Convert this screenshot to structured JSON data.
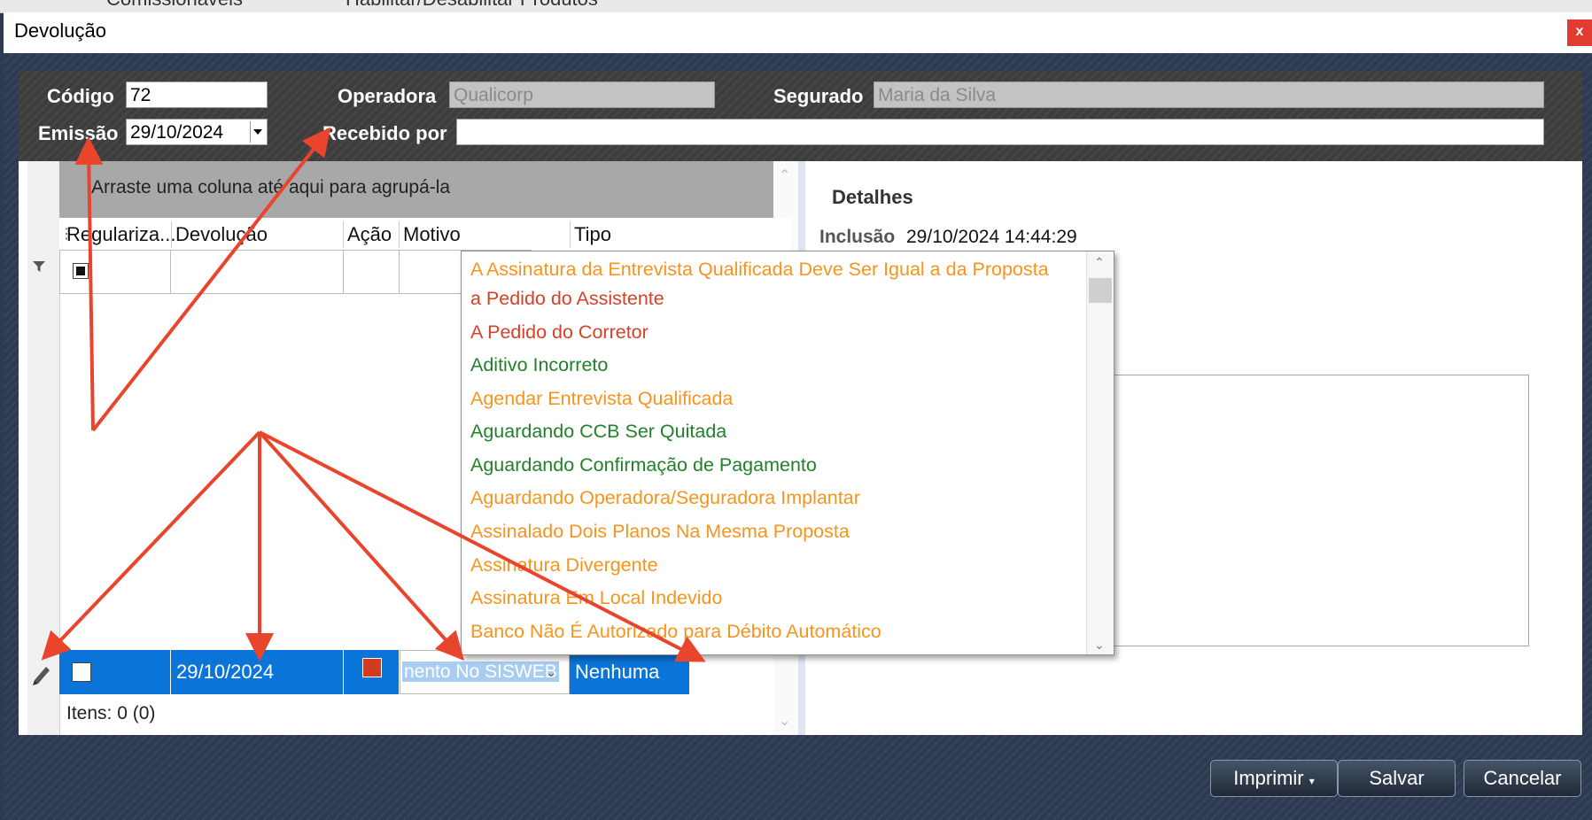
{
  "background_app": {
    "items": [
      "Comissionáveis",
      "Habilitar/Desabilitar Produtos"
    ]
  },
  "window": {
    "title": "Devolução",
    "close_label": "x"
  },
  "header": {
    "codigo_label": "Código",
    "codigo_value": "72",
    "operadora_label": "Operadora",
    "operadora_value": "Qualicorp",
    "segurado_label": "Segurado",
    "segurado_value": "Maria da Silva",
    "emissao_label": "Emissão",
    "emissao_value": "29/10/2024",
    "recebido_label": "Recebido por",
    "recebido_value": ""
  },
  "grid": {
    "group_hint": "Arraste uma coluna até aqui para agrupá-la",
    "columns": [
      "Regulariza...",
      "Devolução",
      "Ação",
      "Motivo",
      "Tipo"
    ],
    "edit_row": {
      "devolucao": "29/10/2024",
      "motivo": "nento No SISWEB",
      "tipo": "Nenhuma"
    },
    "footer": "Itens: 0 (0)"
  },
  "details": {
    "title": "Detalhes",
    "inclusao_label": "Inclusão",
    "inclusao_value": "29/10/2024 14:44:29"
  },
  "motivo_dropdown": {
    "items": [
      {
        "label": "A Assinatura da Entrevista Qualificada Deve Ser Igual a da Proposta",
        "color": "#f7941d"
      },
      {
        "label": "a Pedido do Assistente",
        "color": "#d64127"
      },
      {
        "label": "A Pedido do Corretor",
        "color": "#d64127"
      },
      {
        "label": "Aditivo Incorreto",
        "color": "#23802a"
      },
      {
        "label": "Agendar Entrevista Qualificada",
        "color": "#f7941d"
      },
      {
        "label": "Aguardando CCB Ser Quitada",
        "color": "#23802a"
      },
      {
        "label": "Aguardando Confirmação de Pagamento",
        "color": "#23802a"
      },
      {
        "label": "Aguardando Operadora/Seguradora Implantar",
        "color": "#f7941d"
      },
      {
        "label": "Assinalado Dois Planos Na Mesma Proposta",
        "color": "#f7941d"
      },
      {
        "label": "Assinatura Divergente",
        "color": "#f7941d"
      },
      {
        "label": "Assinatura Em Local Indevido",
        "color": "#f7941d"
      },
      {
        "label": "Banco Não É Autorizado para Débito Automático",
        "color": "#f7941d"
      }
    ]
  },
  "buttons": {
    "imprimir": "Imprimir",
    "salvar": "Salvar",
    "cancelar": "Cancelar"
  },
  "colors": {
    "selection_blue": "#0a74d8",
    "annotation_arrow": "#e8452c",
    "dialog_background": "#2d3a52"
  }
}
